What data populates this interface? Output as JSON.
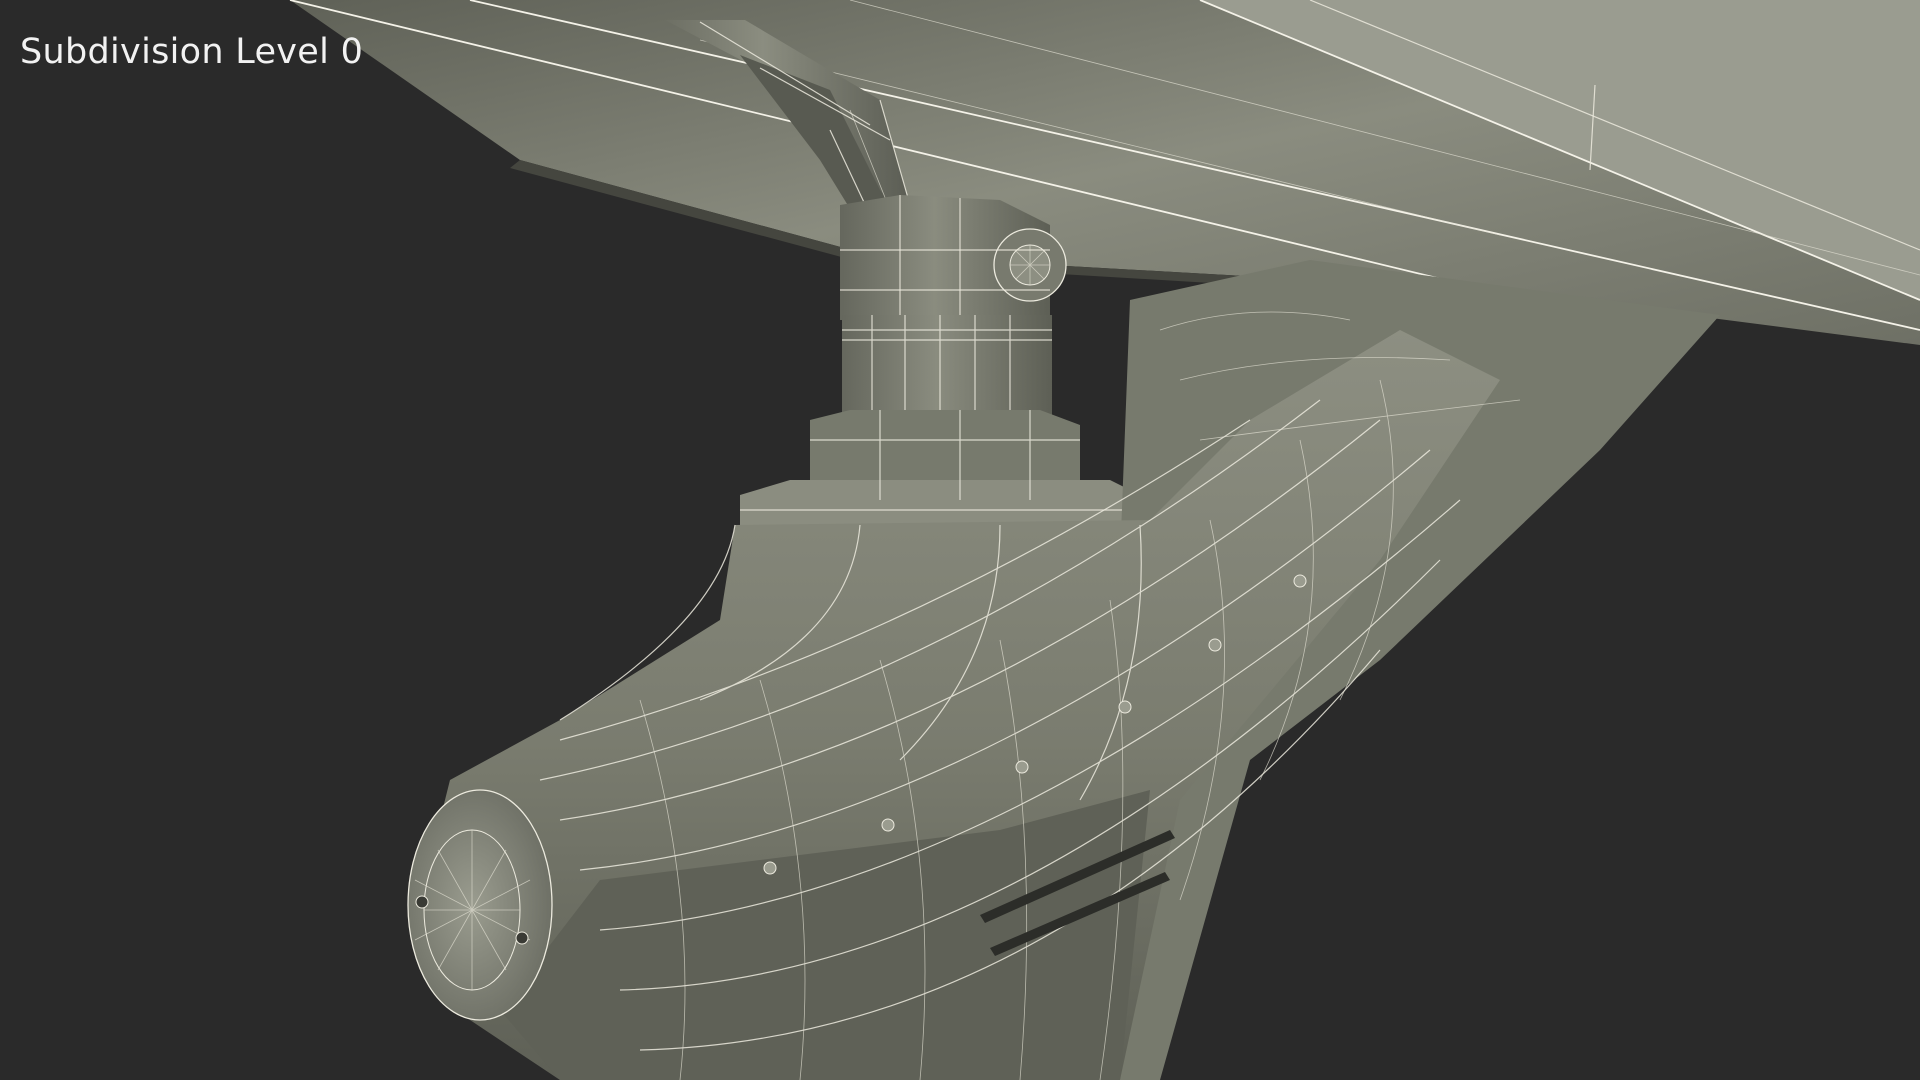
{
  "viewport": {
    "label": "Subdivision Level 0",
    "background_color": "#2a2a2a",
    "mesh_color": "#7c7e70",
    "wire_color": "#eceade"
  }
}
